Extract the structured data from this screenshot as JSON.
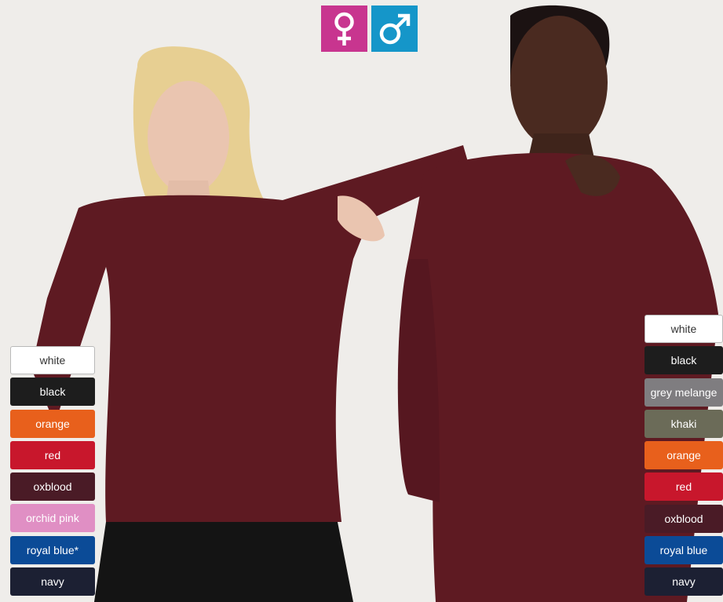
{
  "colors": {
    "female_badge": "#c8358f",
    "male_badge": "#1596c9",
    "background": "#efedea",
    "garment": "#5e1a22"
  },
  "badges": {
    "female_icon": "venus-icon",
    "male_icon": "mars-icon"
  },
  "women_colors": [
    {
      "label": "white",
      "bg": "#ffffff",
      "fg": "#333333"
    },
    {
      "label": "black",
      "bg": "#1d1d1d",
      "fg": "#ffffff"
    },
    {
      "label": "orange",
      "bg": "#e8601c",
      "fg": "#ffffff"
    },
    {
      "label": "red",
      "bg": "#c8172c",
      "fg": "#ffffff"
    },
    {
      "label": "oxblood",
      "bg": "#4a1b26",
      "fg": "#ffffff"
    },
    {
      "label": "orchid pink",
      "bg": "#e08fc4",
      "fg": "#ffffff"
    },
    {
      "label": "royal blue*",
      "bg": "#0b4b97",
      "fg": "#ffffff"
    },
    {
      "label": "navy",
      "bg": "#1c2033",
      "fg": "#ffffff"
    }
  ],
  "men_colors": [
    {
      "label": "white",
      "bg": "#ffffff",
      "fg": "#333333"
    },
    {
      "label": "black",
      "bg": "#1d1d1d",
      "fg": "#ffffff"
    },
    {
      "label": "grey melange",
      "bg": "#7f7d80",
      "fg": "#ffffff"
    },
    {
      "label": "khaki",
      "bg": "#6b6b58",
      "fg": "#ffffff"
    },
    {
      "label": "orange",
      "bg": "#e8601c",
      "fg": "#ffffff"
    },
    {
      "label": "red",
      "bg": "#c8172c",
      "fg": "#ffffff"
    },
    {
      "label": "oxblood",
      "bg": "#4a1b26",
      "fg": "#ffffff"
    },
    {
      "label": "royal blue",
      "bg": "#0b4b97",
      "fg": "#ffffff"
    },
    {
      "label": "navy",
      "bg": "#1c2033",
      "fg": "#ffffff"
    }
  ]
}
